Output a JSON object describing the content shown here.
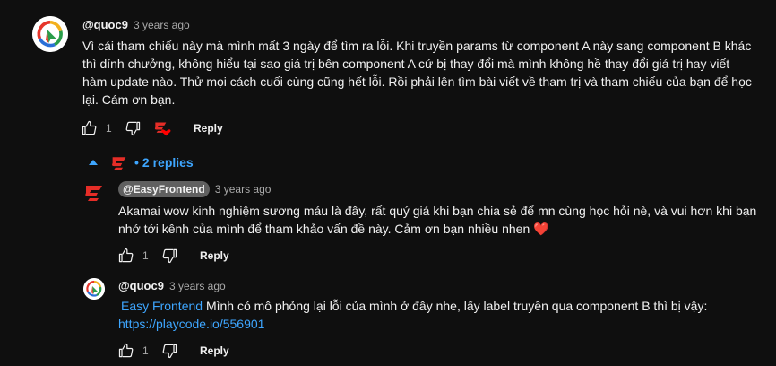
{
  "comment": {
    "author": "@quoc9",
    "time": "3 years ago",
    "text": "Vì cái tham chiếu này mà mình mất 3 ngày để tìm ra lỗi. Khi truyền params từ component A này sang component B khác thì dính chưởng, không hiểu tại sao giá trị bên component A cứ bị thay đổi mà mình không hề thay đổi giá trị hay viết hàm update nào. Thử mọi cách cuối cùng cũng hết lỗi. Rồi phải lên tìm bài viết về tham trị và tham chiếu của bạn để học lại. Cám ơn bạn.",
    "likes": "1",
    "reply_label": "Reply"
  },
  "replies_toggle": {
    "label": "2 replies",
    "bullet": "•"
  },
  "replies": [
    {
      "author": "@EasyFrontend",
      "time": "3 years ago",
      "text": "Akamai wow kinh nghiệm sương máu là đây, rất quý giá khi bạn chia sẻ để mn cùng học hỏi nè, và vui hơn khi bạn nhớ tới kênh của mình để tham khảo vấn đề này. Cảm ơn bạn nhiều nhen ❤️",
      "likes": "1",
      "reply_label": "Reply"
    },
    {
      "author": "@quoc9",
      "time": "3 years ago",
      "mention": "Easy Frontend",
      "text": " Mình có mô phỏng lại lỗi của mình ở đây nhe, lấy label truyền qua component B thì bị vậy:",
      "link": "https://playcode.io/556901",
      "likes": "1",
      "reply_label": "Reply"
    }
  ],
  "icons": [
    "like-icon",
    "dislike-icon",
    "creator-heart-icon",
    "chevron-up-icon",
    "channel-logo-icon"
  ],
  "colors": {
    "background": "#0f0f0f",
    "link": "#3ea6ff",
    "muted": "#aaaaaa",
    "heart": "#ff0000",
    "brand": "#e52d27"
  }
}
